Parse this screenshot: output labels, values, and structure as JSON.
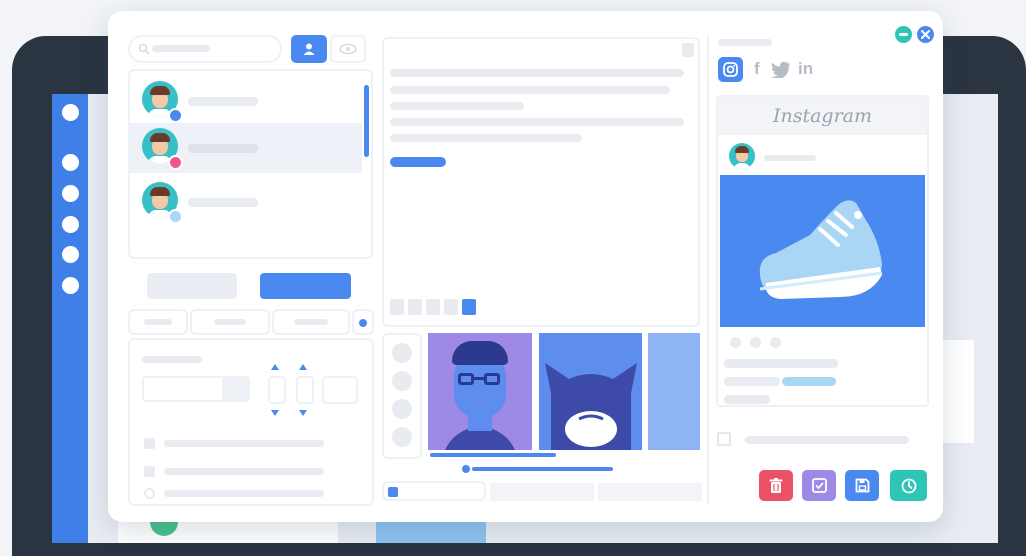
{
  "instagram_card": {
    "title": "Instagram"
  },
  "social_icons": {
    "facebook": "f",
    "linkedin": "in"
  },
  "colors": {
    "accent": "#4a8af0",
    "device": "#2b3441",
    "delete": "#ea5267",
    "approve": "#9e8ae6",
    "save": "#4a8af0",
    "schedule": "#2ec5b6",
    "status_blue": "#4a8af0",
    "status_pink": "#f0568f",
    "status_light": "#a9d6f5"
  },
  "icons": {
    "search": "search-icon",
    "user_tab": "user-icon",
    "view_tab": "eye-icon",
    "minimize": "minimize-icon",
    "close": "close-icon",
    "instagram": "instagram-icon",
    "twitter": "twitter-icon",
    "delete": "trash-icon",
    "approve": "check-icon",
    "save": "save-icon",
    "schedule": "clock-icon"
  }
}
